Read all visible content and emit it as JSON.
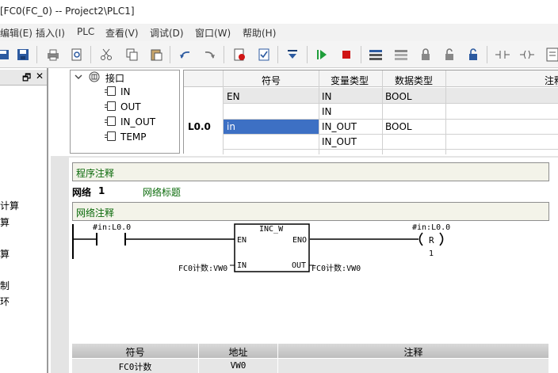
{
  "window": {
    "title": "[FC0(FC_0) -- Project2\\PLC1]"
  },
  "menu": [
    "编辑(E)",
    "插入(I)",
    "PLC",
    "查看(V)",
    "调试(D)",
    "窗口(W)",
    "帮助(H)"
  ],
  "left_pane": {
    "pin": "🗗",
    "close": "✕",
    "items": [
      "计算",
      "算",
      "算",
      "制",
      "环"
    ]
  },
  "tree": {
    "root": "接口",
    "children": [
      "IN",
      "OUT",
      "IN_OUT",
      "TEMP"
    ]
  },
  "var_table": {
    "headers": {
      "symbol": "符号",
      "var_type": "变量类型",
      "data_type": "数据类型",
      "comment": "注释"
    },
    "address_label": "L0.0",
    "rows": [
      {
        "symbol": "EN",
        "var_type": "IN",
        "data_type": "BOOL"
      },
      {
        "symbol": "",
        "var_type": "IN",
        "data_type": ""
      },
      {
        "symbol": "in",
        "var_type": "IN_OUT",
        "data_type": "BOOL"
      },
      {
        "symbol": "",
        "var_type": "IN_OUT",
        "data_type": ""
      }
    ]
  },
  "editor": {
    "program_comment": "程序注释",
    "network_label": "网络",
    "network_number": "1",
    "network_title": "网络标题",
    "network_comment": "网络注释",
    "ladder": {
      "contact_label": "#in:L0.0",
      "block_name": "INC_W",
      "pin_en": "EN",
      "pin_eno": "ENO",
      "pin_in": "IN",
      "pin_out": "OUT",
      "in_operand": "FC0计数:VW0",
      "out_operand": "FC0计数:VW0",
      "coil_label": "#in:L0.0",
      "coil_type": "R",
      "coil_count": "1"
    }
  },
  "symbol_table": {
    "headers": {
      "symbol": "符号",
      "address": "地址",
      "comment": "注释"
    },
    "row": {
      "symbol": "FC0计数",
      "address": "VW0",
      "comment": ""
    }
  },
  "colors": {
    "selection": "#3d70c4",
    "comment_text": "#0a6a0a",
    "run_green": "#1f9e3a",
    "stop_red": "#d01515"
  }
}
